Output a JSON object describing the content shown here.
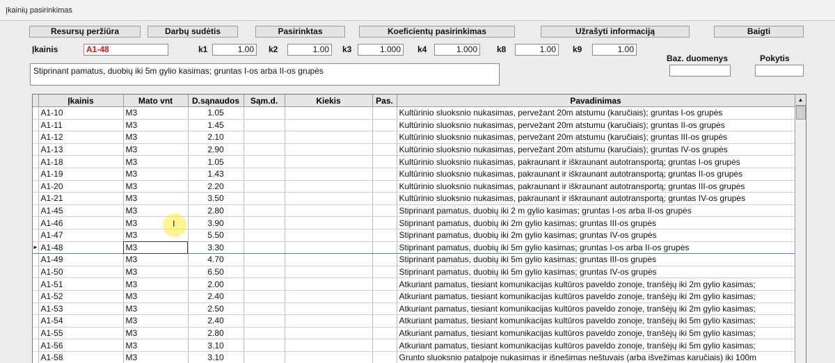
{
  "window": {
    "title": "Įkainių pasirinkimas"
  },
  "toolbar": {
    "resursu": "Resursų peržiūra",
    "darbu": "Darbų sudėtis",
    "pasirinktas": "Pasirinktas",
    "koef": "Koeficientų pasirinkimas",
    "uzrasyti": "Užrašyti informaciją",
    "baigti": "Baigti"
  },
  "form": {
    "ikainis_label": "Įkainis",
    "ikainis_value": "A1-48",
    "k1_label": "k1",
    "k1": "1.00",
    "k2_label": "k2",
    "k2": "1.00",
    "k3_label": "k3",
    "k3": "1.000",
    "k4_label": "k4",
    "k4": "1.000",
    "k8_label": "k8",
    "k8": "1.00",
    "k9_label": "k9",
    "k9": "1.00",
    "baz_label": "Baz. duomenys",
    "baz_value": "",
    "pokytis_label": "Pokytis",
    "pokytis_value": "",
    "description": "Stiprinant pamatus, duobių iki 5m gylio kasimas; gruntas I-os arba II-os grupės"
  },
  "table": {
    "headers": {
      "ikainis": "Įkainis",
      "mato": "Mato vnt",
      "ds": "D.sąnaudos",
      "samd": "Sąm.d.",
      "kiekis": "Kiekis",
      "pas": "Pas.",
      "pav": "Pavadinimas"
    },
    "scroll_up_glyph": "▲",
    "row_indicator_glyph": "►",
    "rows": [
      {
        "code": "A1-10",
        "unit": "M3",
        "ds": "1.05",
        "name": "Kultūrinio sluoksnio nukasimas, pervežant 20m atstumu (karučiais); gruntas I-os grupės"
      },
      {
        "code": "A1-11",
        "unit": "M3",
        "ds": "1.45",
        "name": "Kultūrinio sluoksnio nukasimas, pervežant 20m atstumu (karučiais); gruntas II-os grupės"
      },
      {
        "code": "A1-12",
        "unit": "M3",
        "ds": "2.10",
        "name": "Kultūrinio sluoksnio nukasimas, pervežant 20m atstumu (karučiais); gruntas III-os grupės"
      },
      {
        "code": "A1-13",
        "unit": "M3",
        "ds": "2.90",
        "name": "Kultūrinio sluoksnio nukasimas, pervežant 20m atstumu (karučiais); gruntas IV-os grupės"
      },
      {
        "code": "A1-18",
        "unit": "M3",
        "ds": "1.05",
        "name": "Kultūrinio sluoksnio nukasimas, pakraunant ir iškraunant autotransportą; gruntas I-os grupės"
      },
      {
        "code": "A1-19",
        "unit": "M3",
        "ds": "1.43",
        "name": "Kultūrinio sluoksnio nukasimas, pakraunant ir iškraunant autotransportą; gruntas II-os grupės"
      },
      {
        "code": "A1-20",
        "unit": "M3",
        "ds": "2.20",
        "name": "Kultūrinio sluoksnio nukasimas, pakraunant ir iškraunant autotransportą; gruntas III-os grupės"
      },
      {
        "code": "A1-21",
        "unit": "M3",
        "ds": "3.50",
        "name": "Kultūrinio sluoksnio nukasimas, pakraunant ir iškraunant autotransportą; gruntas IV-os grupės"
      },
      {
        "code": "A1-45",
        "unit": "M3",
        "ds": "2.80",
        "name": "Stiprinant pamatus, duobių iki 2 m gylio kasimas; gruntas I-os arba II-os grupės"
      },
      {
        "code": "A1-46",
        "unit": "M3",
        "ds": "3.90",
        "name": "Stiprinant pamatus, duobių iki 2m gylio kasimas; gruntas III-os grupės"
      },
      {
        "code": "A1-47",
        "unit": "M3",
        "ds": "5.50",
        "name": "Stiprinant pamatus, duobių iki 2m gylio kasimas; gruntas IV-os grupės"
      },
      {
        "code": "A1-48",
        "unit": "M3",
        "ds": "3.30",
        "name": "Stiprinant pamatus, duobių iki 5m gylio kasimas; gruntas I-os arba II-os grupės",
        "selected": true
      },
      {
        "code": "A1-49",
        "unit": "M3",
        "ds": "4.70",
        "name": "Stiprinant pamatus, duobių iki 5m gylio kasimas; gruntas III-os grupės"
      },
      {
        "code": "A1-50",
        "unit": "M3",
        "ds": "6.50",
        "name": "Stiprinant pamatus, duobių iki 5m gylio kasimas; gruntas IV-os grupės"
      },
      {
        "code": "A1-51",
        "unit": "M3",
        "ds": "2.00",
        "name": "Atkuriant pamatus, tiesiant komunikacijas kultūros paveldo zonoje, tranšėjų iki 2m gylio kasimas;"
      },
      {
        "code": "A1-52",
        "unit": "M3",
        "ds": "2.40",
        "name": "Atkuriant pamatus, tiesiant komunikacijas kultūros paveldo zonoje, tranšėjų iki 2m gylio kasimas;"
      },
      {
        "code": "A1-53",
        "unit": "M3",
        "ds": "2.50",
        "name": "Atkuriant pamatus, tiesiant komunikacijas kultūros paveldo zonoje, tranšėjų iki 2m gylio kasimas;"
      },
      {
        "code": "A1-54",
        "unit": "M3",
        "ds": "2.40",
        "name": "Atkuriant pamatus, tiesiant komunikacijas kultūros paveldo zonoje, tranšėjų iki 5m gylio kasimas;"
      },
      {
        "code": "A1-55",
        "unit": "M3",
        "ds": "2.80",
        "name": "Atkuriant pamatus, tiesiant komunikacijas kultūros paveldo zonoje, tranšėjų iki 5m gylio kasimas;"
      },
      {
        "code": "A1-56",
        "unit": "M3",
        "ds": "3.10",
        "name": "Atkuriant pamatus, tiesiant komunikacijas kultūros paveldo zonoje, tranšėjų iki 5m gylio kasimas;"
      },
      {
        "code": "A1-58",
        "unit": "M3",
        "ds": "3.10",
        "name": "Grunto sluoksnio patalpoje nukasimas ir išnešimas neštuvais (arba išvežimas karučiais) iki 100m"
      }
    ]
  },
  "colors": {
    "accent_red": "#e81010",
    "selection_blue": "#4a86c8",
    "cursor_highlight": "#ffeb3c"
  },
  "icons": {
    "mouse_cursor": "text-cursor-icon"
  }
}
